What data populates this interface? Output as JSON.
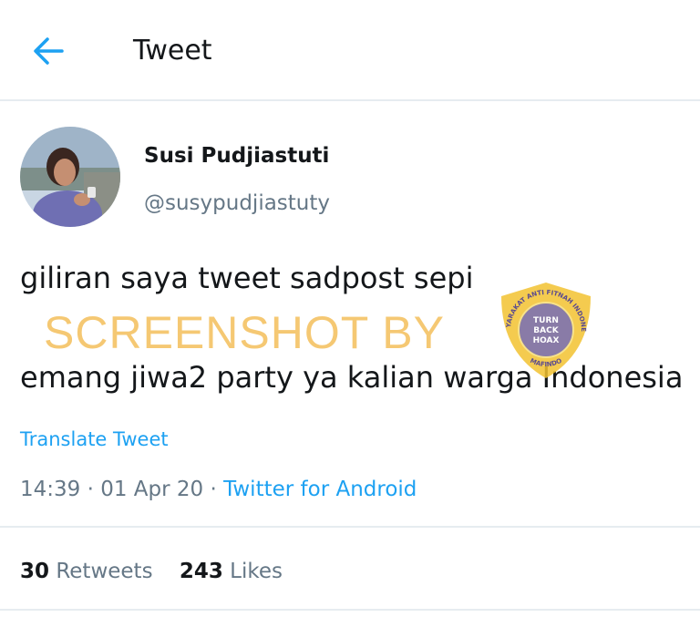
{
  "header": {
    "title": "Tweet",
    "back_icon": "arrow-left-icon"
  },
  "author": {
    "name": "Susi Pudjiastuti",
    "handle": "@susypudjiastuty"
  },
  "tweet": {
    "line1": "giliran saya tweet sadpost sepi",
    "line2": "emang jiwa2 party ya kalian warga Indonesia"
  },
  "watermark": {
    "text": "SCREENSHOT BY",
    "color": "#f4bd55",
    "logo_ring_text": "MASYARAKAT ANTI FITNAH INDONESIA",
    "logo_bottom_text": "MAFINDO",
    "logo_center_lines": [
      "TURN",
      "BACK",
      "HOAX"
    ]
  },
  "translate_label": "Translate Tweet",
  "meta": {
    "time": "14:39",
    "separator": " · ",
    "date": "01 Apr 20",
    "client": "Twitter for Android"
  },
  "stats": {
    "retweets_count": "30",
    "retweets_label": "Retweets",
    "likes_count": "243",
    "likes_label": "Likes"
  },
  "colors": {
    "link": "#1da1f2",
    "muted": "#657786",
    "text": "#14171a",
    "divider": "#e6ecf0"
  }
}
